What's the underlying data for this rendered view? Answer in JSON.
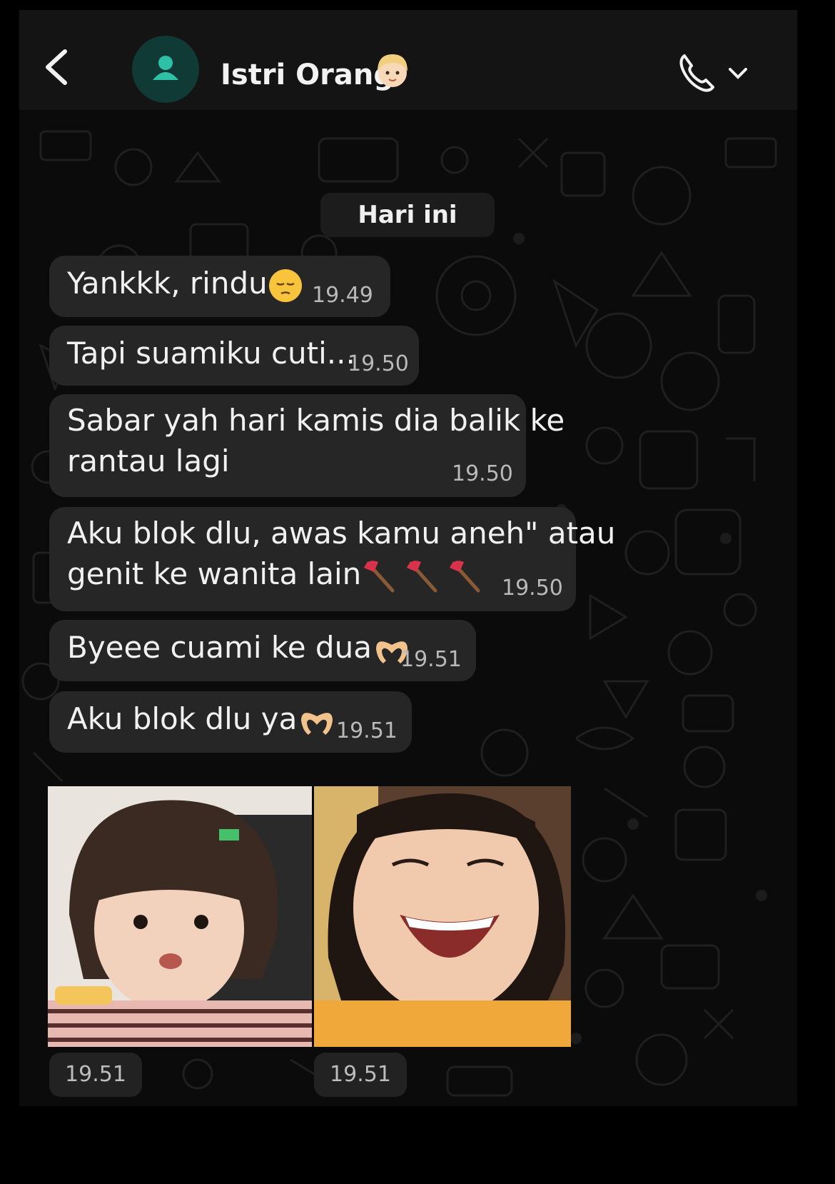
{
  "header": {
    "contact_name": "Istri Orang",
    "back_icon": "chevron-left-icon",
    "avatar_icon": "person-icon",
    "name_emoji": "woman-blond-emoji",
    "call_icon": "phone-icon",
    "call_menu_icon": "chevron-down-icon"
  },
  "date_separator": "Hari ini",
  "messages": [
    {
      "text": "Yankkk, rindu",
      "emoji": "pensive-face-emoji",
      "time": "19.49"
    },
    {
      "text": "Tapi suamiku cuti...",
      "time": "19.50"
    },
    {
      "line1": "Sabar yah hari kamis dia balik ke",
      "line2": "rantau lagi",
      "time": "19.50"
    },
    {
      "line1": "Aku blok dlu, awas kamu aneh\" atau",
      "line2": "genit ke wanita lain",
      "emoji": "axe-emoji",
      "time": "19.50"
    },
    {
      "text": "Byeee cuami ke dua",
      "emoji": "heart-hands-emoji",
      "time": "19.51"
    },
    {
      "text": "Aku blok dlu ya",
      "emoji": "heart-hands-emoji",
      "time": "19.51"
    }
  ],
  "photos": [
    {
      "name": "photo-girl-surprised",
      "time": "19.51"
    },
    {
      "name": "photo-girl-laughing",
      "time": "19.51"
    }
  ],
  "colors": {
    "background": "#0b0b0b",
    "bubble": "#262626",
    "header": "#141414",
    "avatar": "#103a36",
    "avatar_icon": "#2fc0a8"
  }
}
